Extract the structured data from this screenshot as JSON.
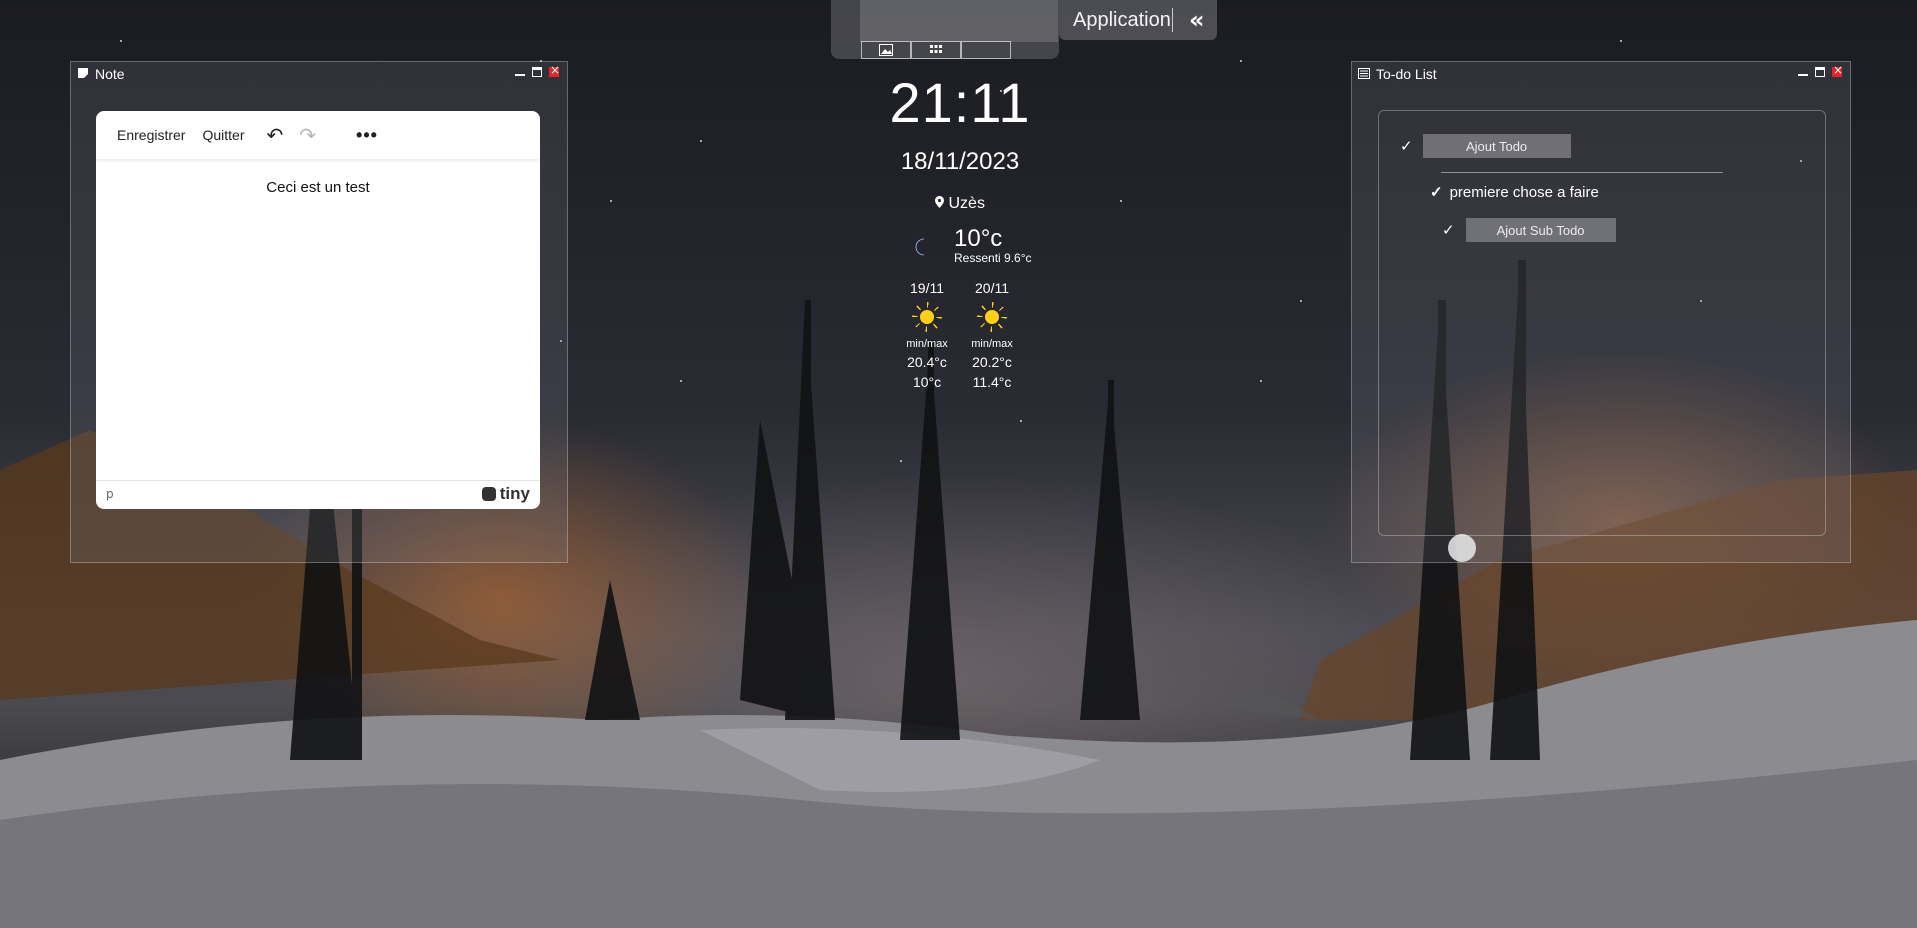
{
  "topbar": {
    "app_label": "Application",
    "collapse_icon": "double-chevron-left-icon",
    "tabs": [
      {
        "icon": "image-icon"
      },
      {
        "icon": "grid-icon"
      },
      {
        "icon": "blank-tab"
      }
    ]
  },
  "note_window": {
    "title": "Note",
    "title_icon": "note-icon",
    "toolbar": {
      "save_label": "Enregistrer",
      "quit_label": "Quitter",
      "undo_icon": "undo-icon",
      "redo_icon": "redo-icon",
      "more_icon": "more-icon"
    },
    "content": "Ceci est un test",
    "statusbar": {
      "path": "p",
      "brand": "tiny"
    }
  },
  "weather": {
    "time": "21:11",
    "date": "18/11/2023",
    "location": "Uzès",
    "current_temp": "10°c",
    "feels_like": "Ressenti 9.6°c",
    "current_icon": "moon-icon",
    "forecast": [
      {
        "date": "19/11",
        "icon": "sun-icon",
        "label": "min/max",
        "max": "20.4°c",
        "min": "10°c"
      },
      {
        "date": "20/11",
        "icon": "sun-icon",
        "label": "min/max",
        "max": "20.2°c",
        "min": "11.4°c"
      }
    ]
  },
  "todo_window": {
    "title": "To-do List",
    "title_icon": "list-icon",
    "add_todo_label": "Ajout Todo",
    "items": [
      {
        "text": "premiere chose a faire",
        "add_sub_label": "Ajout Sub Todo"
      }
    ]
  },
  "colors": {
    "close_button": "#e0242a",
    "moon": "#2a78e6",
    "sun": "#ffcf1a"
  }
}
